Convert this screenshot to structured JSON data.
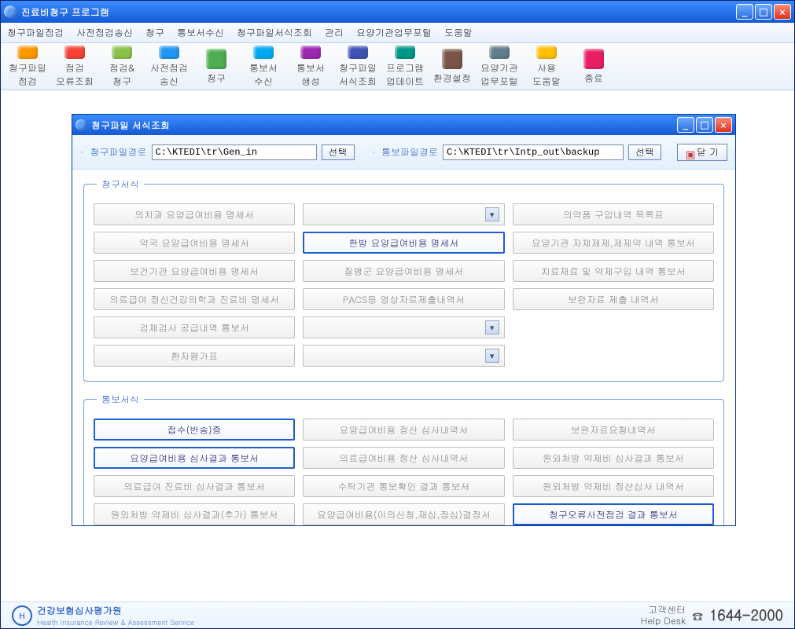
{
  "window": {
    "title": "진료비청구 프로그램"
  },
  "menu": [
    "청구파일점검",
    "사전점검송신",
    "청구",
    "통보서수신",
    "청구파일서식조회",
    "관리",
    "요양기관업무포털",
    "도움말"
  ],
  "toolbar": [
    {
      "label": "청구파일\n점검",
      "name": "tool-claim-file-check"
    },
    {
      "label": "점검\n오류조회",
      "name": "tool-check-error"
    },
    {
      "label": "점검&\n청구",
      "name": "tool-check-claim"
    },
    {
      "label": "사전점검\n송신",
      "name": "tool-precheck-send"
    },
    {
      "label": "청구",
      "name": "tool-claim"
    },
    {
      "label": "통보서\n수신",
      "name": "tool-notice-recv"
    },
    {
      "label": "통보서\n생성",
      "name": "tool-notice-gen"
    },
    {
      "label": "청구파일\n서식조회",
      "name": "tool-claim-form"
    },
    {
      "label": "프로그램\n업데이트",
      "name": "tool-update"
    },
    {
      "label": "환경설정",
      "name": "tool-settings"
    },
    {
      "label": "요양기관\n업무포털",
      "name": "tool-portal"
    },
    {
      "label": "사용\n도움말",
      "name": "tool-help"
    },
    {
      "label": "종료",
      "name": "tool-exit"
    }
  ],
  "popup": {
    "title": "청구파일 서식조회",
    "path1_label": "청구파일경로",
    "path1_value": "C:\\KTEDI\\tr\\Gen_in",
    "path2_label": "통보파일경로",
    "path2_value": "C:\\KTEDI\\tr\\Intp_out\\backup",
    "select_btn": "선택",
    "close_btn": "닫 기",
    "group1_title": "청구서식",
    "group2_title": "통보서식",
    "forms1": [
      {
        "t": "의치과 요양급여비용 명세서",
        "a": false
      },
      {
        "t": "",
        "d": true
      },
      {
        "t": "의약품 구입내역 목록표",
        "a": false
      },
      {
        "t": "약국 요양급여비용 명세서",
        "a": false
      },
      {
        "t": "한방 요양급여비용 명세서",
        "a": true
      },
      {
        "t": "요양기관 자체제제,제제약 내역 통보서",
        "a": false
      },
      {
        "t": "보건기관 요양급여비용 명세서",
        "a": false
      },
      {
        "t": "질병군 요양급여비용 명세서",
        "a": false
      },
      {
        "t": "치료재료 및 약제구입 내역 통보서",
        "a": false
      },
      {
        "t": "의료급여 정신건강의학과 진료비 명세서",
        "a": false
      },
      {
        "t": "PACS등 영상자료제출내역서",
        "a": false
      },
      {
        "t": "보완자료 제출 내역서",
        "a": false
      },
      {
        "t": "검체검사 공급내역 통보서",
        "a": false
      },
      {
        "t": "",
        "d": true
      },
      {
        "t": "",
        "e": true
      },
      {
        "t": "환자평가표",
        "a": false
      },
      {
        "t": "",
        "d": true
      },
      {
        "t": "",
        "e": true
      }
    ],
    "forms2": [
      {
        "t": "접수(반송)증",
        "a": true
      },
      {
        "t": "요양급여비용 정산 심사내역서",
        "a": false
      },
      {
        "t": "보완자료요청내역서",
        "a": false
      },
      {
        "t": "요양급여비용 심사결과 통보서",
        "a": true
      },
      {
        "t": "의료급여비용 정산 심사내역서",
        "a": false
      },
      {
        "t": "원외처방 약제비 심사결과 통보서",
        "a": false
      },
      {
        "t": "의료급여 진료비 심사결과 통보서",
        "a": false
      },
      {
        "t": "수탁기관 통보확인 결과 통보서",
        "a": false
      },
      {
        "t": "원외처방 약제비 정산심사 내역서",
        "a": false
      },
      {
        "t": "원외처방 약제비 심사결과(추가) 통보서",
        "a": false
      },
      {
        "t": "요양급여비용(이의신청,재심,정심)결정서",
        "a": false
      },
      {
        "t": "청구오류사전점검 결과 통보서",
        "a": true
      }
    ]
  },
  "footer": {
    "org_name": "건강보험심사평가원",
    "org_sub": "Health Insurance Review & Assessment Service",
    "helpdesk_label_kr": "고객센터",
    "helpdesk_label_en": "Help Desk",
    "phone": "1644-2000"
  }
}
